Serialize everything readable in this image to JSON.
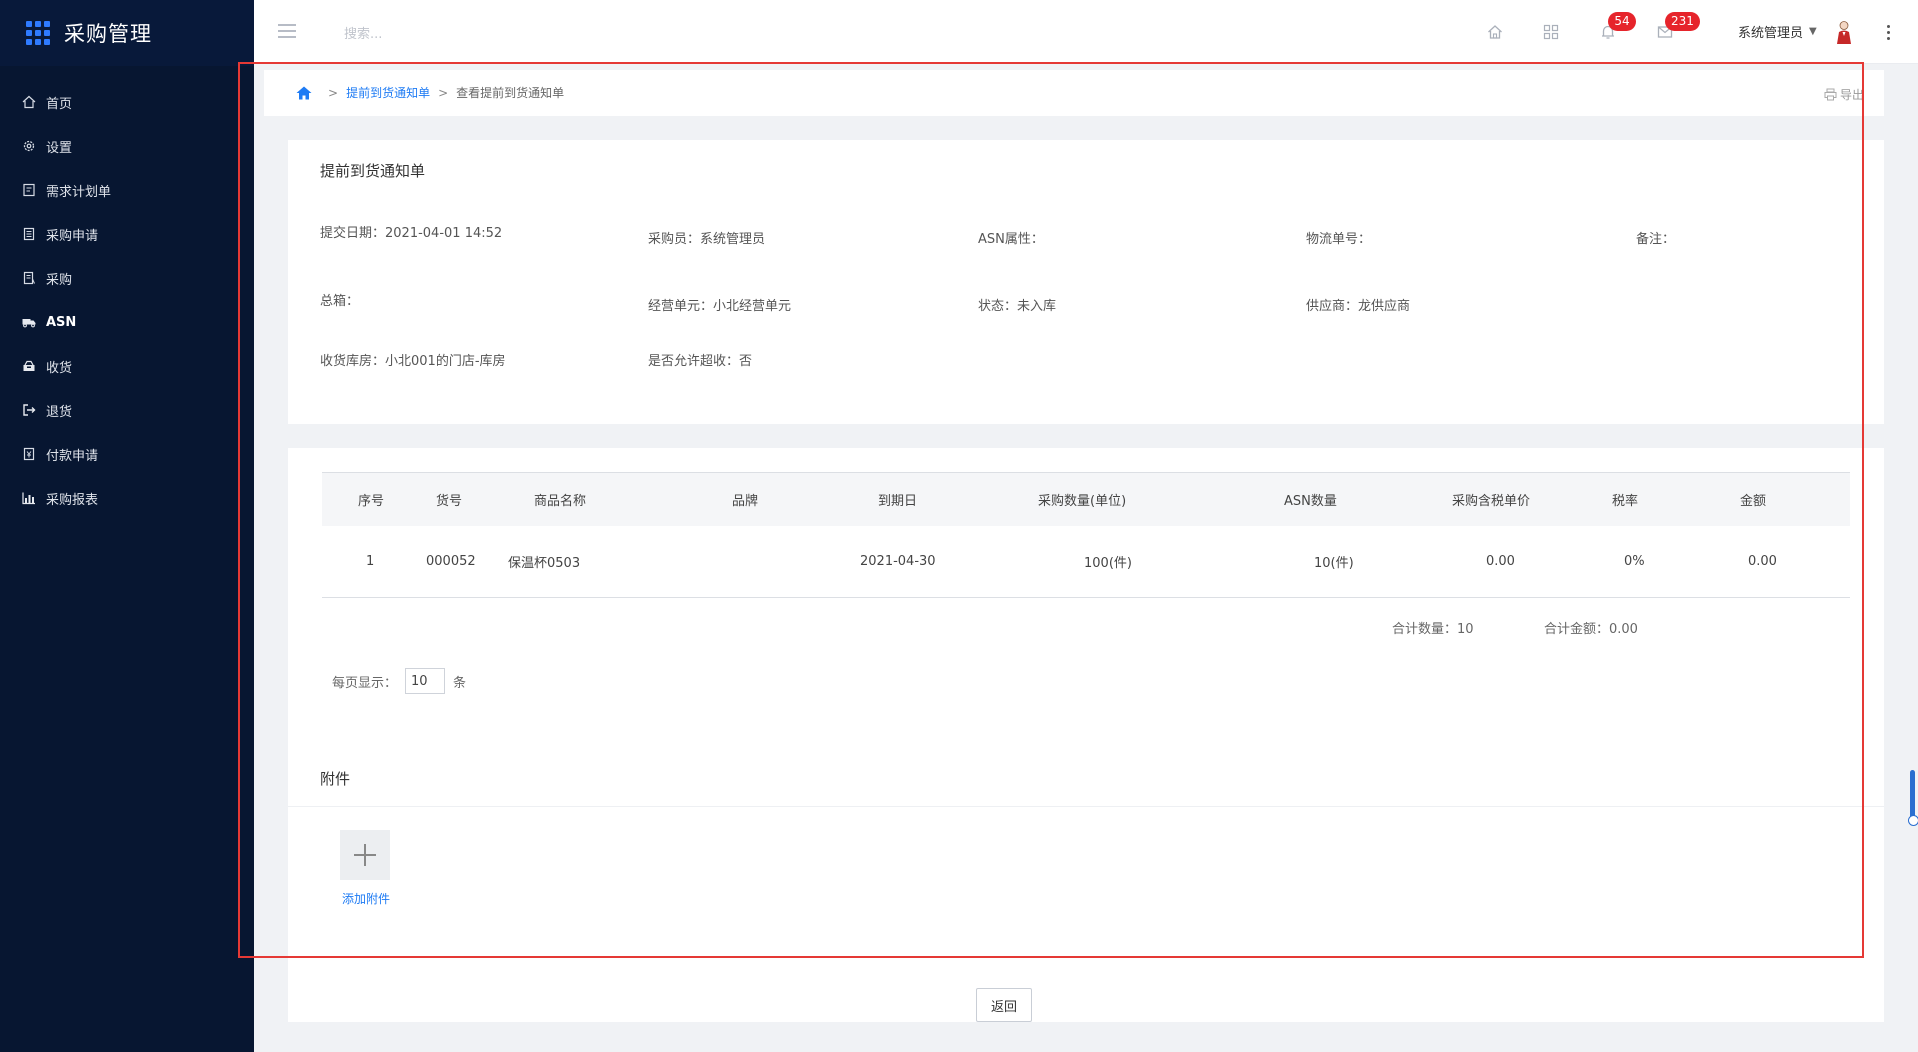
{
  "sidebar": {
    "title": "采购管理",
    "items": [
      {
        "label": "首页",
        "icon": "home-icon"
      },
      {
        "label": "设置",
        "icon": "gear-icon"
      },
      {
        "label": "需求计划单",
        "icon": "plan-doc-icon"
      },
      {
        "label": "采购申请",
        "icon": "request-doc-icon"
      },
      {
        "label": "采购",
        "icon": "purchase-doc-icon"
      },
      {
        "label": "ASN",
        "icon": "truck-icon",
        "active": true
      },
      {
        "label": "收货",
        "icon": "inbox-icon"
      },
      {
        "label": "退货",
        "icon": "return-icon"
      },
      {
        "label": "付款申请",
        "icon": "payment-icon"
      },
      {
        "label": "采购报表",
        "icon": "bar-chart-icon"
      }
    ]
  },
  "topbar": {
    "search_placeholder": "搜索...",
    "notifications_count": "54",
    "messages_count": "231",
    "user_name": "系统管理员"
  },
  "breadcrumb": {
    "link": "提前到货通知单",
    "current": "查看提前到货通知单",
    "export_label": "导出"
  },
  "detail": {
    "title": "提前到货通知单",
    "fields": {
      "submit_date": {
        "label": "提交日期：",
        "value": "2021-04-01 14:52"
      },
      "buyer": {
        "label": "采购员：",
        "value": "系统管理员"
      },
      "asn_attr": {
        "label": "ASN属性：",
        "value": ""
      },
      "logistics_no": {
        "label": "物流单号：",
        "value": ""
      },
      "remark": {
        "label": "备注：",
        "value": ""
      },
      "total_boxes": {
        "label": "总箱：",
        "value": ""
      },
      "business_unit": {
        "label": "经营单元：",
        "value": "小北经营单元"
      },
      "status": {
        "label": "状态：",
        "value": "未入库"
      },
      "supplier": {
        "label": "供应商：",
        "value": "龙供应商"
      },
      "warehouse": {
        "label": "收货库房：",
        "value": "小北001的门店-库房"
      },
      "over_receive": {
        "label": "是否允许超收：",
        "value": "否"
      }
    }
  },
  "table": {
    "headers": {
      "seq": "序号",
      "code": "货号",
      "name": "商品名称",
      "brand": "品牌",
      "due": "到期日",
      "qty": "采购数量(单位)",
      "asn_qty": "ASN数量",
      "price": "采购含税单价",
      "tax": "税率",
      "amount": "金额"
    },
    "rows": [
      {
        "seq": "1",
        "code": "000052",
        "name": "保温杯0503",
        "brand": "",
        "due": "2021-04-30",
        "qty": "100(件)",
        "asn_qty": "10(件)",
        "price": "0.00",
        "tax": "0%",
        "amount": "0.00"
      }
    ],
    "total_qty": "合计数量：10",
    "total_amount": "合计金额：0.00",
    "page_size_label": "每页显示：",
    "page_size_value": "10",
    "page_size_unit": "条"
  },
  "attachments": {
    "title": "附件",
    "add_label": "添加附件"
  },
  "footer": {
    "back_label": "返回"
  }
}
